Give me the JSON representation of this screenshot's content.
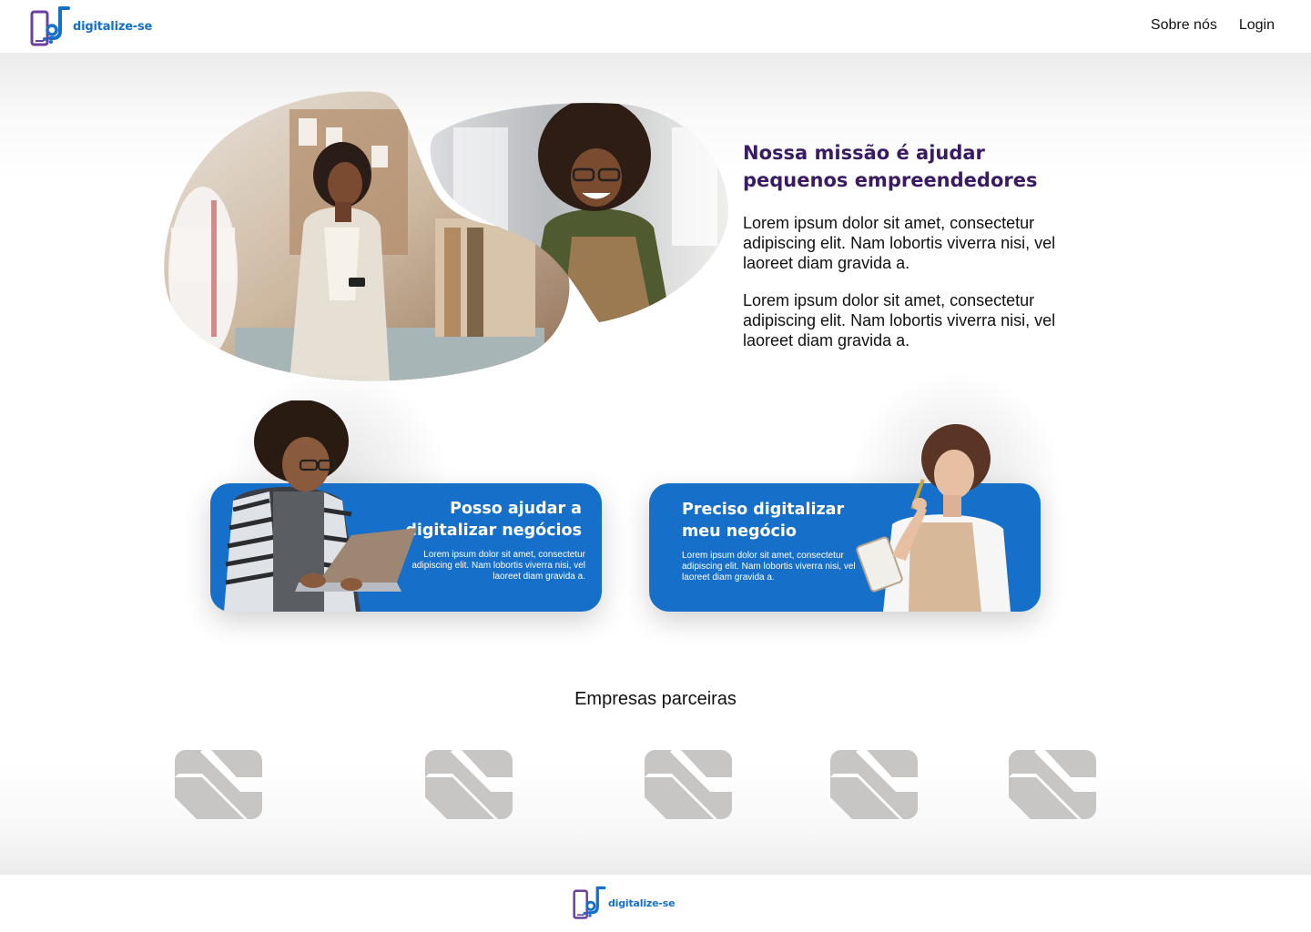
{
  "brand": {
    "name": "digitalize-se",
    "primary_color": "#1670c9",
    "accent_color": "#6a3fa0",
    "title_color": "#3a1a63"
  },
  "header": {
    "logo_icon": "digitalize-se-logo",
    "nav": [
      {
        "label": "Sobre nós"
      },
      {
        "label": "Login"
      }
    ]
  },
  "mission": {
    "title": "Nossa missão é ajudar pequenos empreendedores",
    "paragraphs": [
      "Lorem ipsum dolor sit amet, consectetur adipiscing elit. Nam lobortis viverra nisi, vel laoreet diam gravida a.",
      "Lorem ipsum dolor sit amet, consectetur adipiscing elit. Nam lobortis viverra nisi, vel laoreet diam gravida a."
    ]
  },
  "cards": [
    {
      "title": "Posso ajudar a digitalizar negócios",
      "text": "Lorem ipsum dolor sit amet, consectetur adipiscing elit. Nam lobortis viverra nisi, vel laoreet diam gravida a."
    },
    {
      "title": "Preciso digitalizar meu negócio",
      "text": "Lorem ipsum dolor sit amet, consectetur adipiscing elit. Nam lobortis viverra nisi, vel laoreet diam gravida a."
    }
  ],
  "partners": {
    "title": "Empresas parceiras",
    "logos": [
      "partner-logo-placeholder",
      "partner-logo-placeholder",
      "partner-logo-placeholder",
      "partner-logo-placeholder",
      "partner-logo-placeholder"
    ]
  },
  "footer": {
    "brand": "digitalize-se"
  }
}
